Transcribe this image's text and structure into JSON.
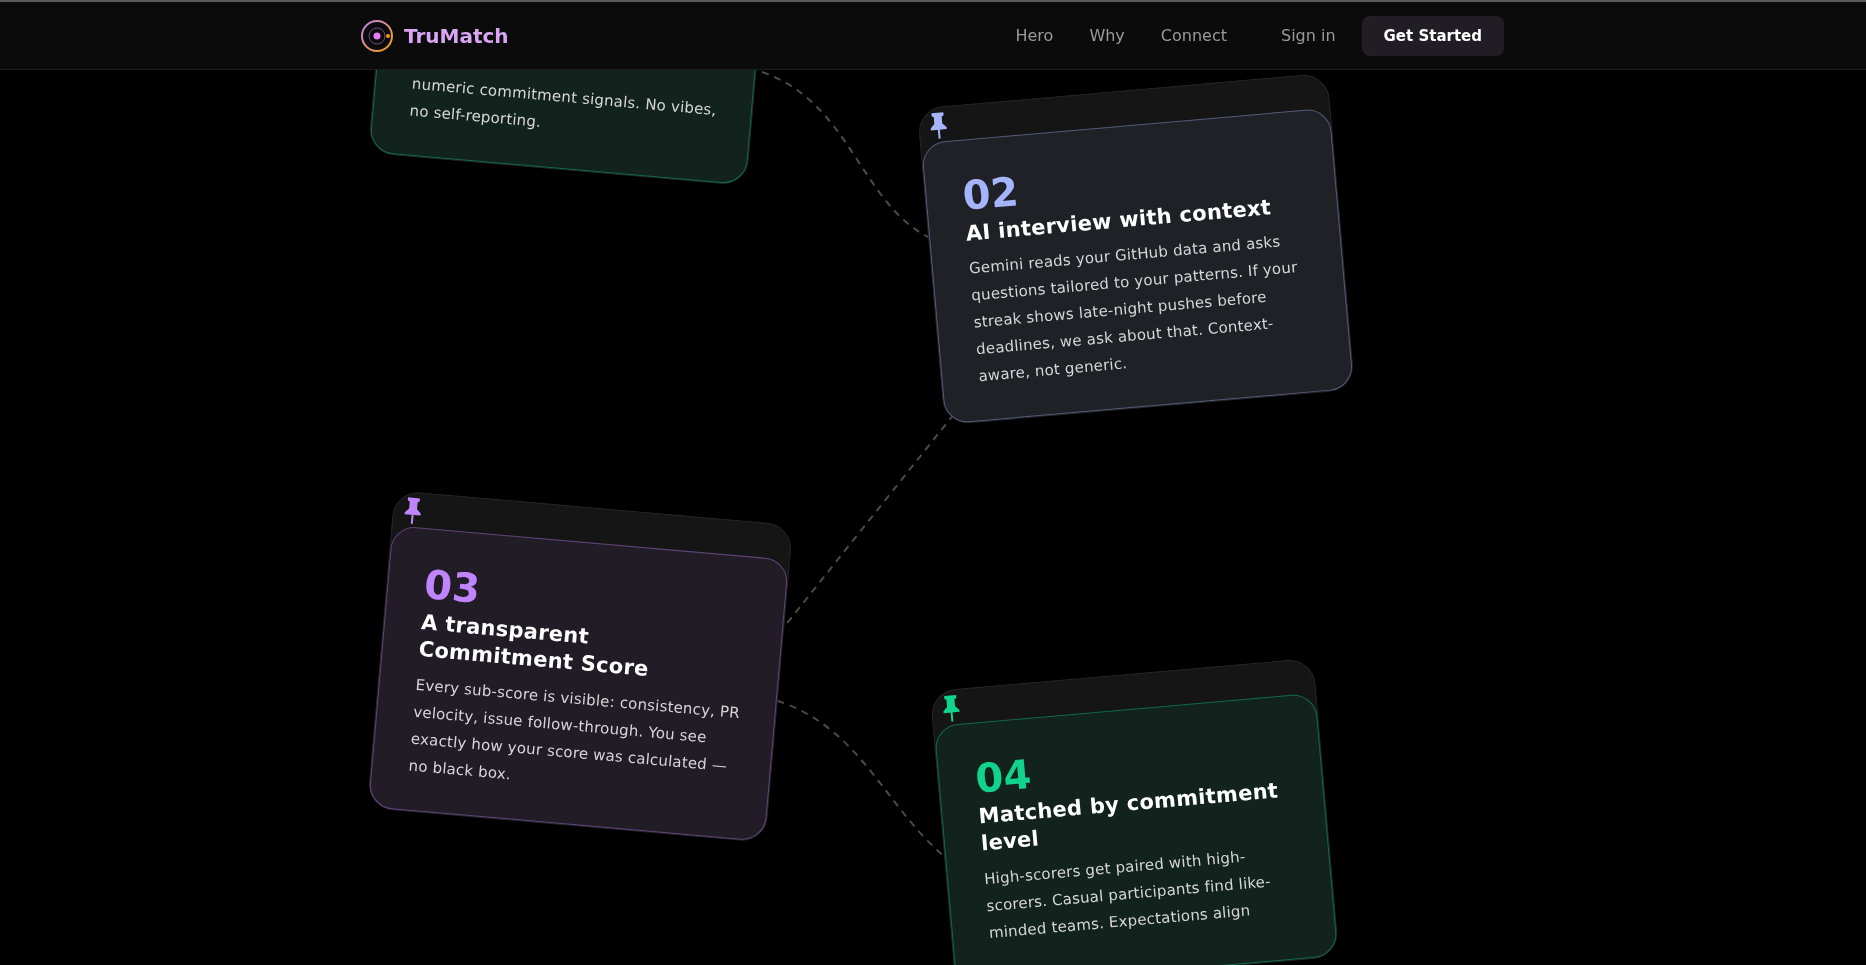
{
  "nav": {
    "brand": "TruMatch",
    "links": [
      {
        "label": "Hero"
      },
      {
        "label": "Why"
      },
      {
        "label": "Connect"
      }
    ],
    "sign_in": "Sign in",
    "cta": "Get Started"
  },
  "steps": [
    {
      "body": "numeric commitment signals. No vibes, no self-reporting."
    },
    {
      "number": "02",
      "title": "AI interview with context",
      "body": "Gemini reads your GitHub data and asks questions tailored to your patterns. If your streak shows late-night pushes before deadlines, we ask about that. Context-aware, not generic.",
      "color": "#a5b4fc"
    },
    {
      "number": "03",
      "title": "A transparent Commitment Score",
      "body": "Every sub-score is visible: consistency, PR velocity, issue follow-through. You see exactly how your score was calculated — no black box.",
      "color": "#c084fc"
    },
    {
      "number": "04",
      "title": "Matched by commitment level",
      "body": "High-scorers get paired with high-scorers. Casual participants find like-minded teams. Expectations align",
      "color": "#10d48e"
    }
  ]
}
